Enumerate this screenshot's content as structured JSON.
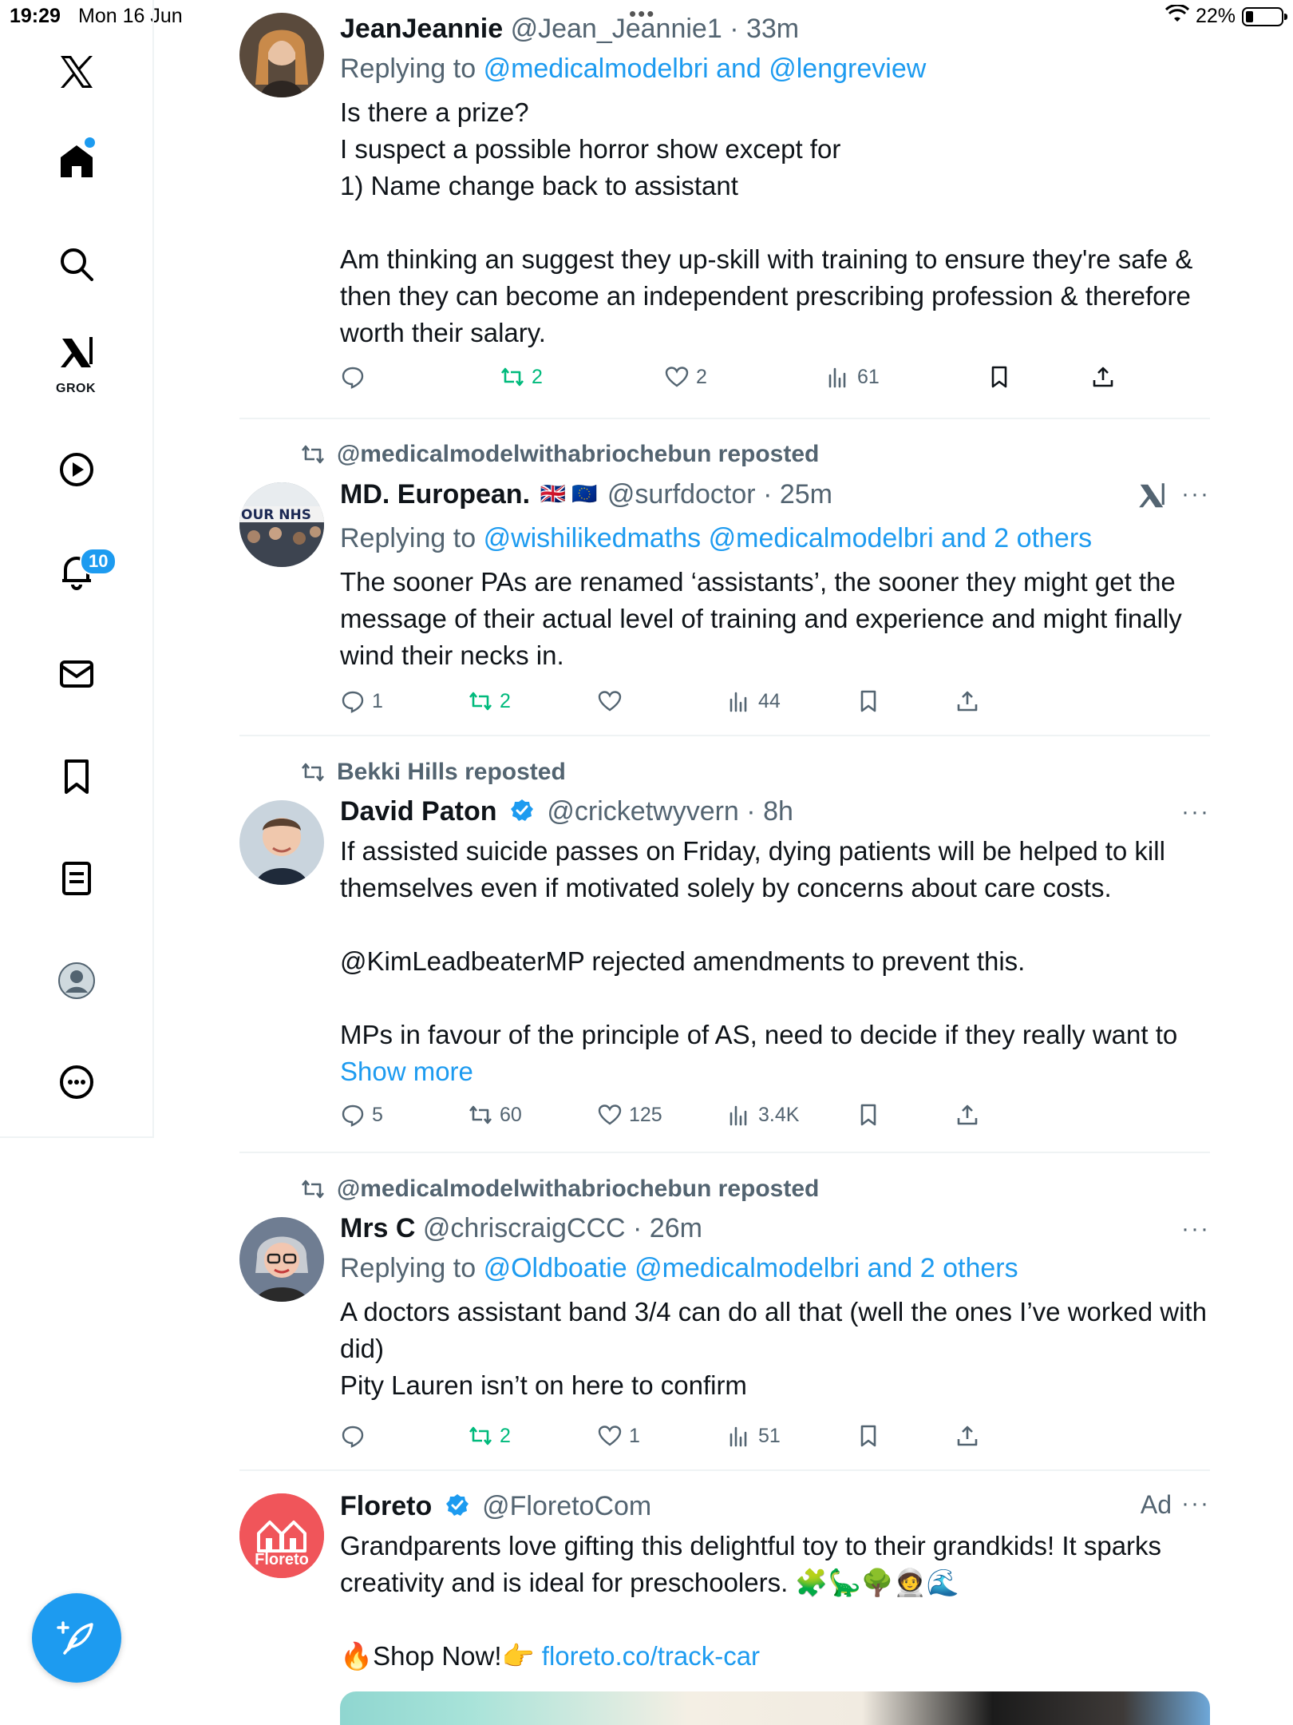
{
  "status_bar": {
    "time": "19:29",
    "date": "Mon 16 Jun",
    "battery": "22%"
  },
  "sidebar": {
    "grok_label": "GROK",
    "notifications_count": "10"
  },
  "tweets": [
    {
      "name": "JeanJeannie",
      "handle": "@Jean_Jeannie1",
      "time": "33m",
      "reply_prefix": "Replying to",
      "reply_to": "@medicalmodelbri and @lengreview",
      "text": "Is there a prize?\nI suspect a possible horror show except for\n1) Name change back to assistant\n\nAm thinking an suggest they up-skill with training to ensure they're safe & then they can become an independent prescribing profession & therefore worth their salary.",
      "replies": "",
      "reposts": "2",
      "likes": "2",
      "views": "61"
    },
    {
      "repost_by": "@medicalmodelwithabriochebun reposted",
      "name": "MD. European.",
      "flags": "🇬🇧 🇪🇺",
      "handle": "@surfdoctor",
      "time": "25m",
      "reply_prefix": "Replying to",
      "reply_to": "@wishilikedmaths @medicalmodelbri and 2 others",
      "text": "The sooner PAs are renamed ‘assistants’, the sooner they might get the message of their actual level of training and experience and might finally wind their necks in.",
      "replies": "1",
      "reposts": "2",
      "likes": "",
      "views": "44"
    },
    {
      "repost_by": "Bekki Hills reposted",
      "name": "David Paton",
      "handle": "@cricketwyvern",
      "time": "8h",
      "text": "If assisted suicide passes on Friday, dying patients will be helped to kill themselves even if motivated solely by concerns about care costs.\n\n@KimLeadbeaterMP rejected amendments to prevent this.\n\nMPs in favour of the principle of AS, need to decide if they really want to ",
      "show_more": "Show more",
      "replies": "5",
      "reposts": "60",
      "likes": "125",
      "views": "3.4K"
    },
    {
      "repost_by": "@medicalmodelwithabriochebun reposted",
      "name": "Mrs C",
      "handle": "@chriscraigCCC",
      "time": "26m",
      "reply_prefix": "Replying to",
      "reply_to": "@Oldboatie @medicalmodelbri and 2 others",
      "text": "A doctors assistant band 3/4 can do all that (well the ones I’ve worked with did)\nPity Lauren isn’t on here to confirm",
      "replies": "",
      "reposts": "2",
      "likes": "1",
      "views": "51"
    },
    {
      "name": "Floreto",
      "handle": "@FloretoCom",
      "ad_label": "Ad",
      "avatar_text": "Floreto",
      "text": "Grandparents love gifting this delightful toy to their grandkids! It sparks creativity and is ideal for preschoolers. 🧩🦕🌳🧑‍🚀🌊\n\n🔥Shop Now!👉 ",
      "link": "floreto.co/track-car"
    }
  ],
  "colors": {
    "accent": "#1d9bf0",
    "repost_active": "#00ba7c",
    "secondary_text": "#536471",
    "divider": "#eff3f4"
  }
}
